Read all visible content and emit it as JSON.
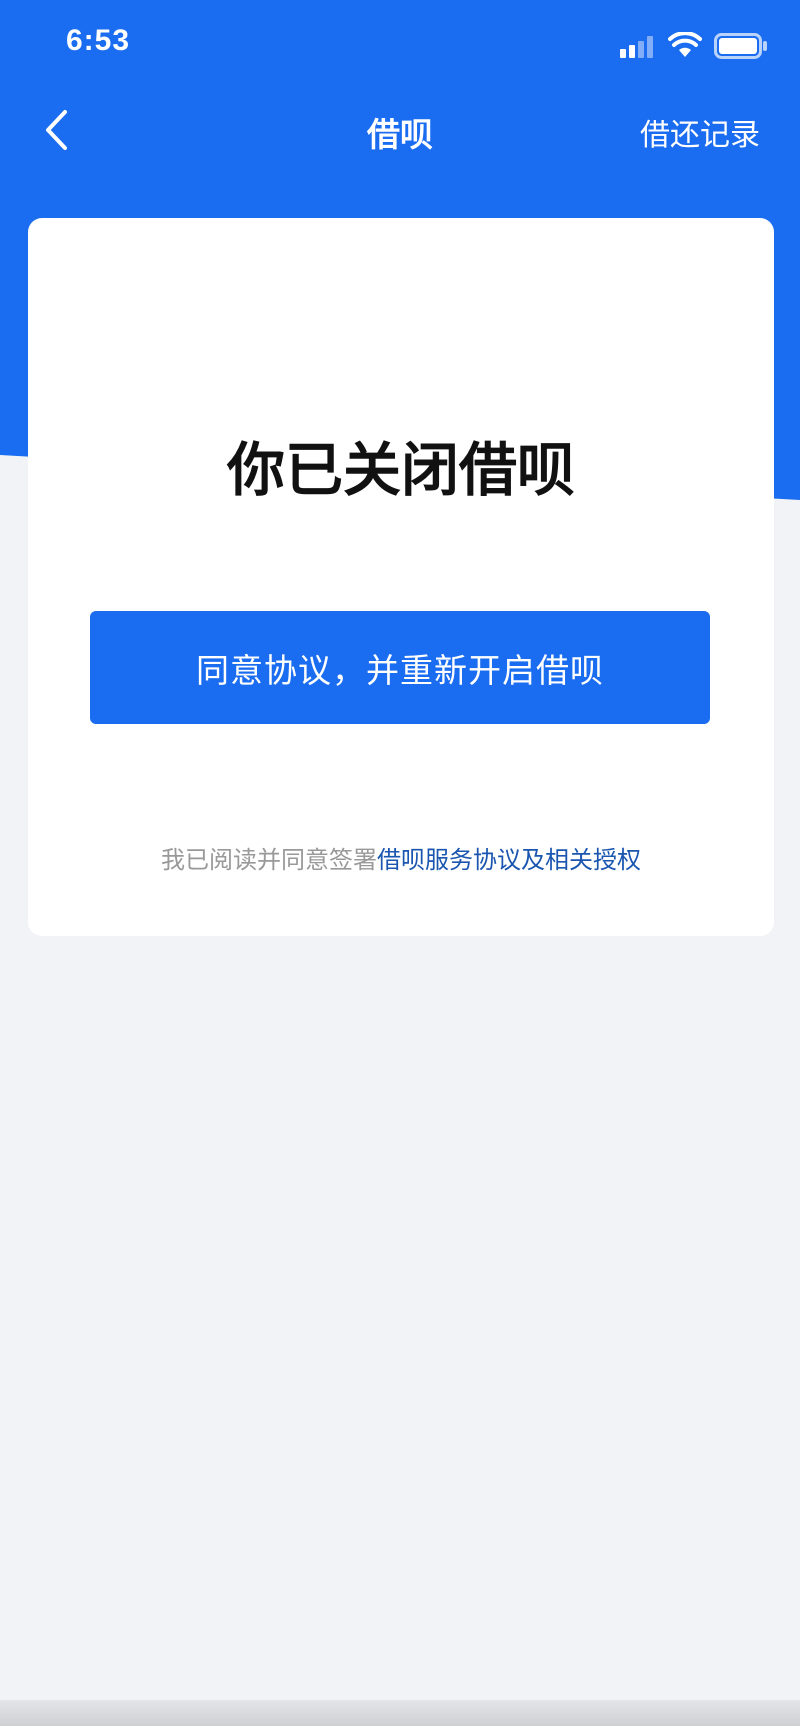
{
  "status_bar": {
    "time": "6:53"
  },
  "nav": {
    "title": "借呗",
    "right_link": "借还记录"
  },
  "card": {
    "title": "你已关闭借呗",
    "button_label": "同意协议，并重新开启借呗",
    "agreement_prefix": "我已阅读并同意签署",
    "agreement_link": "借呗服务协议及相关授权"
  },
  "colors": {
    "brand_blue": "#1a6cf0",
    "link_blue": "#1a56b0",
    "page_bg": "#f2f3f7"
  },
  "icons": {
    "back": "chevron-left-icon",
    "signal": "signal-icon",
    "wifi": "wifi-icon",
    "battery": "battery-icon"
  }
}
